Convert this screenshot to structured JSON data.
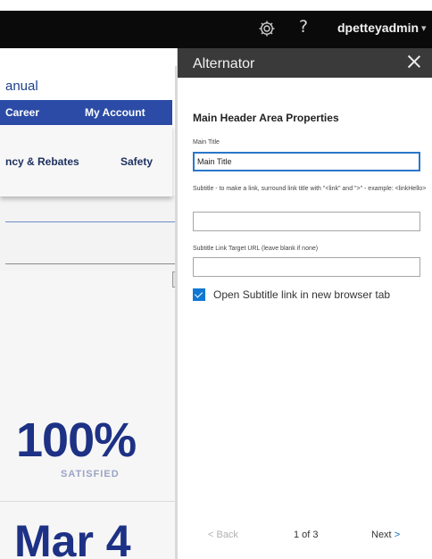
{
  "topbar": {
    "icons": [
      "gear-icon",
      "help-icon",
      "chevron-down-icon"
    ],
    "help_glyph": "?",
    "username": "dpetteyadmin",
    "caret_glyph": "▾"
  },
  "background_page": {
    "manual_text": "anual",
    "nav": {
      "career": "Career",
      "my_account": "My Account"
    },
    "menu": {
      "rebates": "ncy & Rebates",
      "safety": "Safety"
    },
    "stat_value": "100%",
    "stat_label": "SATISFIED",
    "date_text": "Mar 4",
    "colors": {
      "brand_blue": "#2b4ba6",
      "headline_blue": "#1d3185"
    }
  },
  "panel": {
    "title": "Alternator",
    "section_title": "Main Header Area Properties",
    "fields": {
      "main_title_label": "Main Title",
      "main_title_value": "Main Title",
      "subtitle_label": "Subtitle - to make a link, surround link title with \"<link\" and \">\" - example: <linkHello>",
      "subtitle_value": "",
      "subtitle_url_label": "Subtitle Link Target URL (leave blank if none)",
      "subtitle_url_value": ""
    },
    "checkbox": {
      "label": "Open Subtitle link in new browser tab",
      "checked": true
    },
    "footer": {
      "back": "< Back",
      "page": "1 of 3",
      "next": "Next",
      "next_chev": ">"
    },
    "colors": {
      "accent": "#0f78d4",
      "header_bg": "#3a3a3a"
    }
  }
}
